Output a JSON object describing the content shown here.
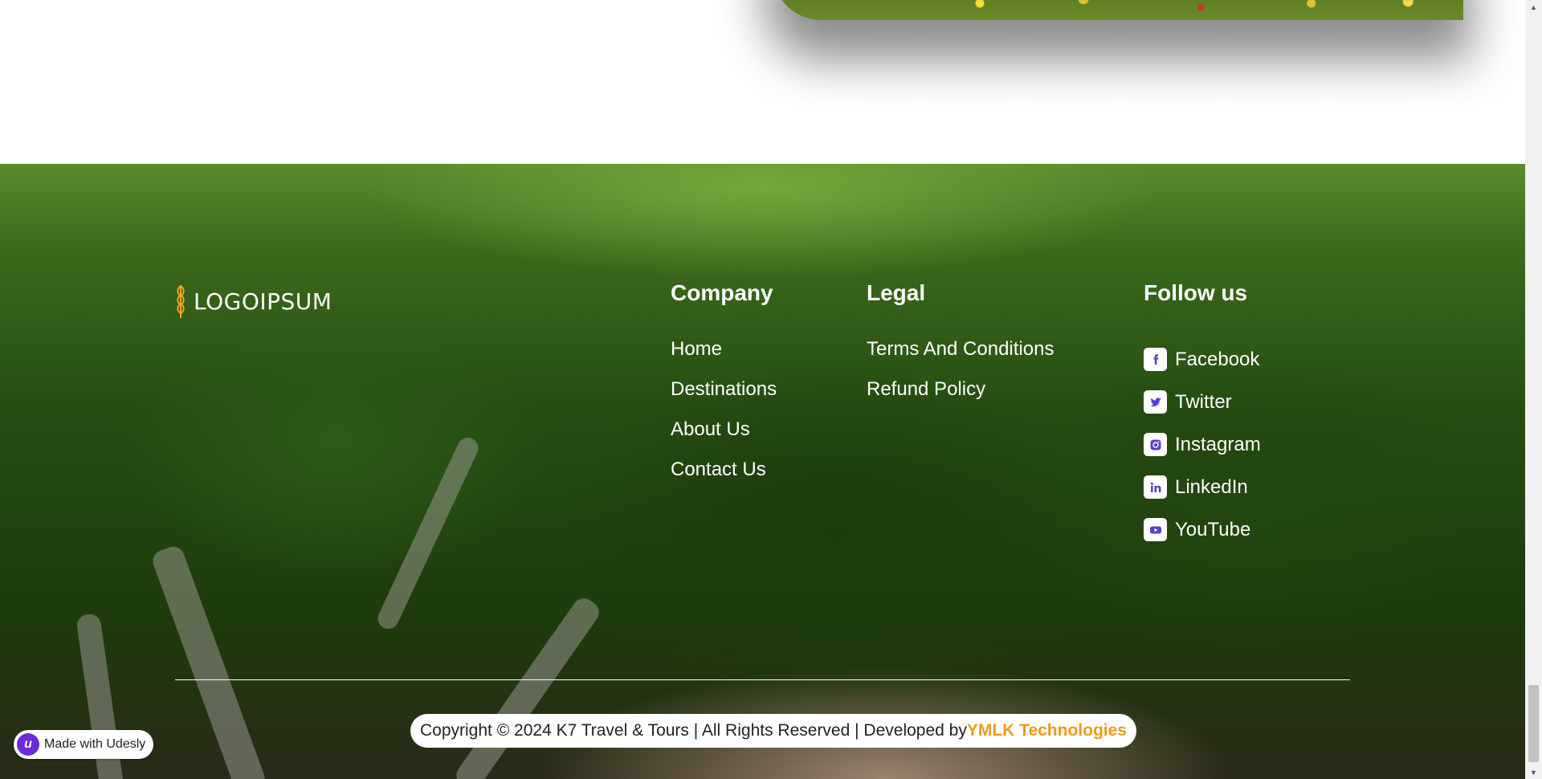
{
  "brand": {
    "logo_text": "LOGOIPSUM",
    "logo_color": "#f5a623"
  },
  "footer": {
    "company": {
      "heading": "Company",
      "links": [
        "Home",
        "Destinations",
        "About Us",
        "Contact Us"
      ]
    },
    "legal": {
      "heading": "Legal",
      "links": [
        "Terms And Conditions",
        "Refund Policy"
      ]
    },
    "follow": {
      "heading": "Follow us",
      "links": [
        {
          "label": "Facebook",
          "icon": "facebook-icon"
        },
        {
          "label": "Twitter",
          "icon": "twitter-icon"
        },
        {
          "label": "Instagram",
          "icon": "instagram-icon"
        },
        {
          "label": "LinkedIn",
          "icon": "linkedin-icon"
        },
        {
          "label": "YouTube",
          "icon": "youtube-icon"
        }
      ],
      "icon_color": "#5b3fd6"
    },
    "copyright_text": "Copyright © 2024 K7 Travel & Tours | All Rights Reserved | Developed by",
    "developer_link": "YMLK Technologies",
    "developer_color": "#f29a1a"
  },
  "badge": {
    "label": "Made with Udesly",
    "mark": "u",
    "color": "#6b2bd9"
  }
}
